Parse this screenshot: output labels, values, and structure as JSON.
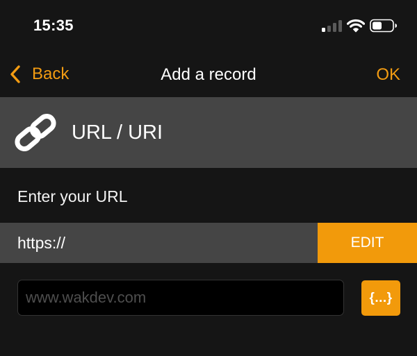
{
  "status_bar": {
    "time": "15:35",
    "signal_icon": "cellular-signal-icon",
    "wifi_icon": "wifi-icon",
    "battery_icon": "battery-icon",
    "signal_bars_active": 1,
    "battery_level": 0.4
  },
  "nav": {
    "back_label": "Back",
    "back_icon": "chevron-left-icon",
    "title": "Add a record",
    "ok_label": "OK"
  },
  "record": {
    "icon": "link-icon",
    "type_label": "URL / URI"
  },
  "form": {
    "prompt": "Enter your URL",
    "scheme_value": "https://",
    "edit_label": "EDIT",
    "url_value": "",
    "url_placeholder": "www.wakdev.com",
    "variables_label": "{...}"
  },
  "colors": {
    "accent": "#f29a0b",
    "background": "#151515",
    "panel": "#454545",
    "input_background": "#000000"
  }
}
